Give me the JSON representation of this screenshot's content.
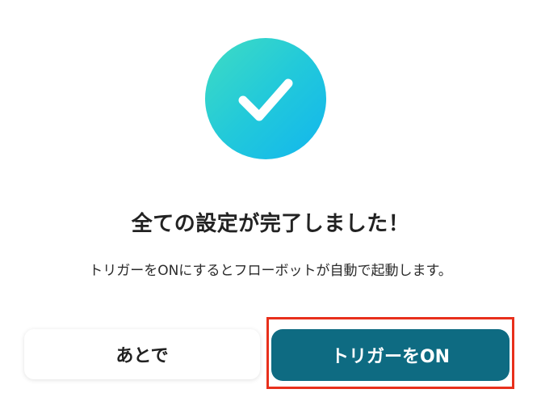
{
  "dialog": {
    "title": "全ての設定が完了しました！",
    "message": "トリガーをONにするとフローボットが自動で起動します。",
    "success_icon": "checkmark-icon",
    "accent_gradient": [
      "#3fdcc3",
      "#12b6ee"
    ]
  },
  "actions": {
    "later_label": "あとで",
    "trigger_on_label": "トリガーをON",
    "primary_color": "#0e6b82",
    "highlight_color": "#e8301c"
  }
}
